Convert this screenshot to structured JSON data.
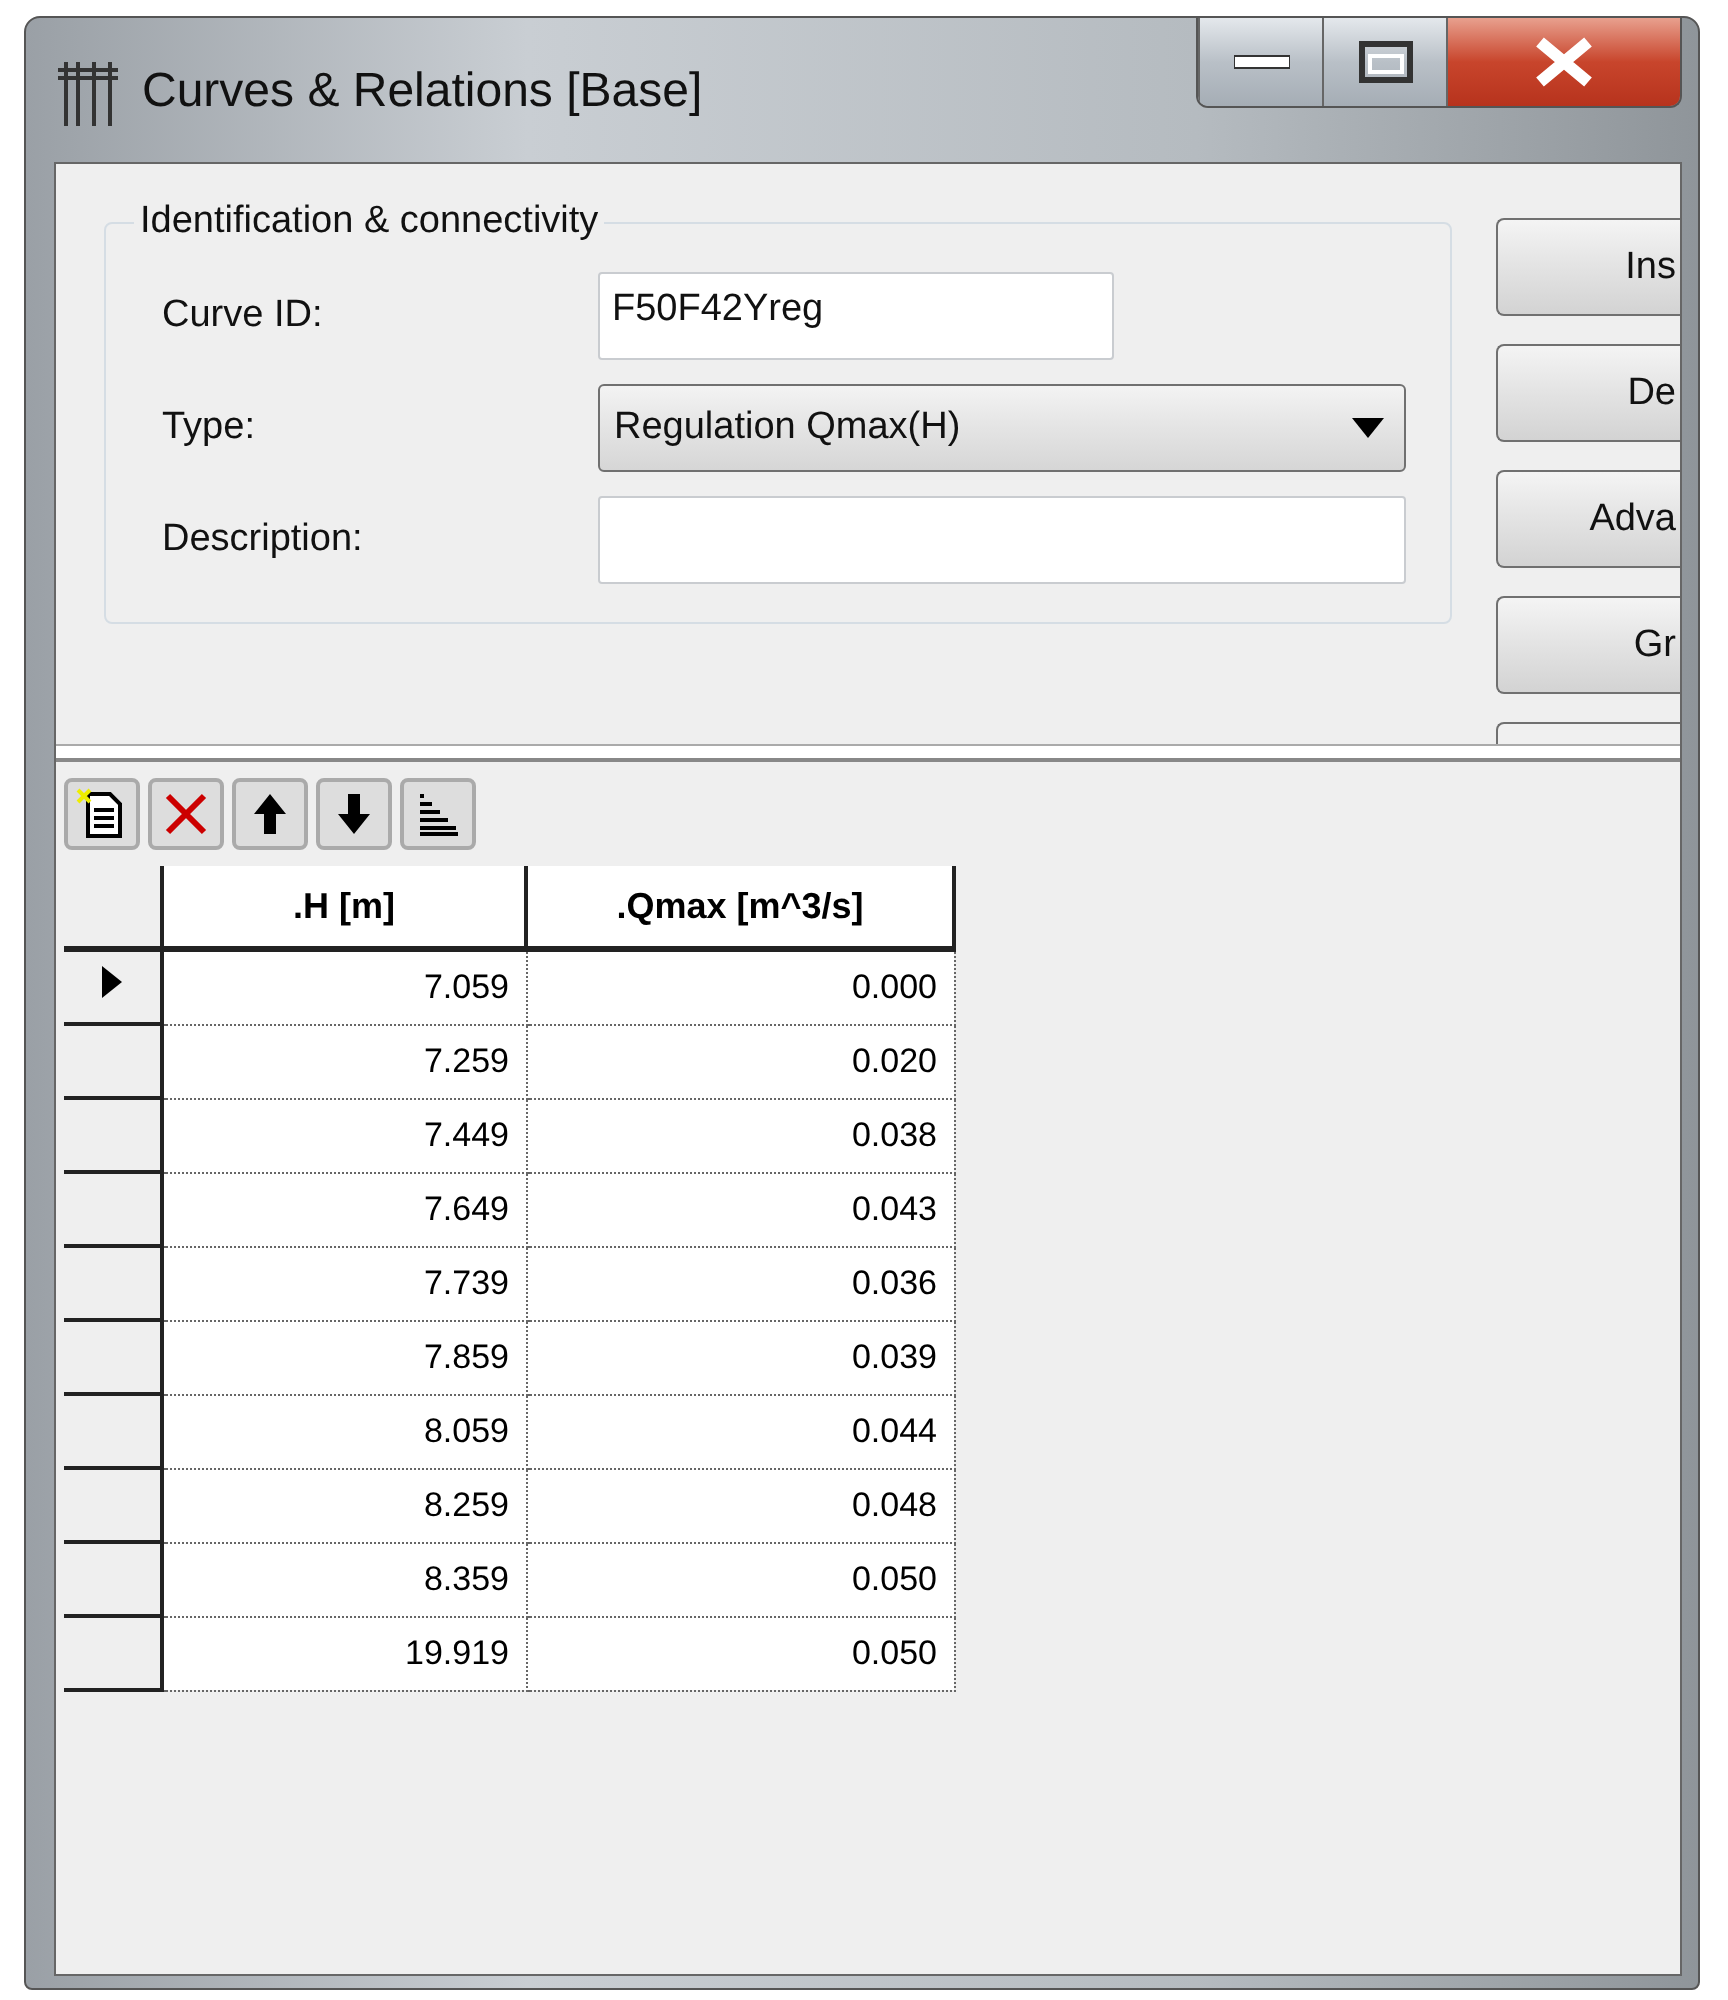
{
  "window": {
    "title": "Curves & Relations [Base]"
  },
  "group": {
    "legend": "Identification & connectivity",
    "fields": [
      {
        "kind": "input",
        "label": "Curve ID:",
        "value": "F50F42Yreg"
      },
      {
        "kind": "dropdown",
        "label": "Type:",
        "value": "Regulation Qmax(H)"
      },
      {
        "kind": "input",
        "label": "Description:"
      }
    ]
  },
  "side_buttons": [
    "Ins",
    "De",
    "Adva",
    "Gr"
  ],
  "table": {
    "columns": [
      ".H [m]",
      ".Qmax [m^3/s]"
    ],
    "rows": [
      {
        "cells": [
          "7.059",
          "0.000"
        ],
        "selected": true
      },
      {
        "cells": [
          "7.259",
          "0.020"
        ],
        "selected": false
      },
      {
        "cells": [
          "7.449",
          "0.038"
        ],
        "selected": false
      },
      {
        "cells": [
          "7.649",
          "0.043"
        ],
        "selected": false
      },
      {
        "cells": [
          "7.739",
          "0.036"
        ],
        "selected": false
      },
      {
        "cells": [
          "7.859",
          "0.039"
        ],
        "selected": false
      },
      {
        "cells": [
          "8.059",
          "0.044"
        ],
        "selected": false
      },
      {
        "cells": [
          "8.259",
          "0.048"
        ],
        "selected": false
      },
      {
        "cells": [
          "8.359",
          "0.050"
        ],
        "selected": false
      },
      {
        "cells": [
          "19.919",
          "0.050"
        ],
        "selected": false
      }
    ]
  }
}
